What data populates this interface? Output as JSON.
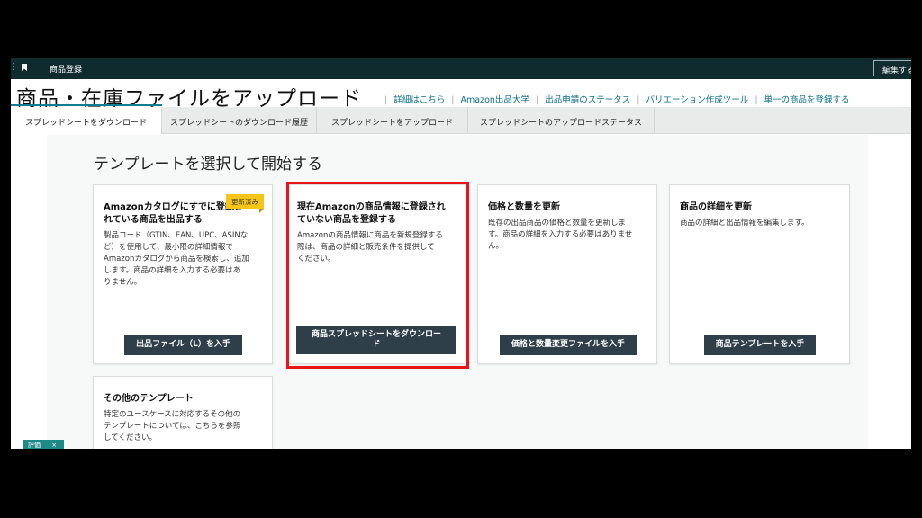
{
  "topbar": {
    "title": "商品登録",
    "edit_label": "編集する"
  },
  "header": {
    "title": "商品・在庫ファイルをアップロード",
    "links": [
      "詳細はこちら",
      "Amazon出品大学",
      "出品申請のステータス",
      "バリエーション作成ツール",
      "単一の商品を登録する"
    ]
  },
  "tabs": [
    "スプレッドシートをダウンロード",
    "スプレッドシートのダウンロード履歴",
    "スプレッドシートをアップロード",
    "スプレッドシートのアップロードステータス"
  ],
  "main": {
    "section_title": "テンプレートを選択して開始する",
    "cards": [
      {
        "title_line1": "Amazonカタログにすでに登録さ",
        "title_line2": "れている商品を出品する",
        "badge": "更新済み",
        "desc": [
          "製品コード（GTIN、EAN、UPC、ASINな",
          "ど）を使用して、最小限の詳細情報で",
          "Amazonカタログから商品を検索し、追加",
          "します。商品の詳細を入力する必要はあ",
          "りません。"
        ],
        "button": "出品ファイル（L）を入手"
      },
      {
        "title_line1": "現在Amazonの商品情報に登録され",
        "title_line2": "ていない商品を登録する",
        "desc": [
          "Amazonの商品情報に商品を新規登録する",
          "際は、商品の詳細と販売条件を提供して",
          "ください。"
        ],
        "button_line1": "商品スプレッドシートをダウンロー",
        "button_line2": "ド"
      },
      {
        "title_line1": "価格と数量を更新",
        "desc": [
          "既存の出品商品の価格と数量を更新しま",
          "す。商品の詳細を入力する必要はありませ",
          "ん。"
        ],
        "button": "価格と数量変更ファイルを入手"
      },
      {
        "title_line1": "商品の詳細を更新",
        "desc": [
          "商品の詳細と出品情報を編集します。"
        ],
        "button": "商品テンプレートを入手"
      },
      {
        "title_line1": "その他のテンプレート",
        "desc": [
          "特定のユースケースに対応するその他の",
          "テンプレートについては、こちらを参照",
          "してください。"
        ]
      }
    ]
  },
  "feedback_chip": {
    "label": "評価",
    "close": "×"
  },
  "colors": {
    "topbar": "#0f2b2e",
    "link": "#0b6f8a",
    "button": "#2f3f4a",
    "badge": "#f5c518",
    "highlight": "#e8141c",
    "chip": "#1e8a88"
  },
  "icons": [
    "bookmark-icon",
    "close-icon"
  ]
}
